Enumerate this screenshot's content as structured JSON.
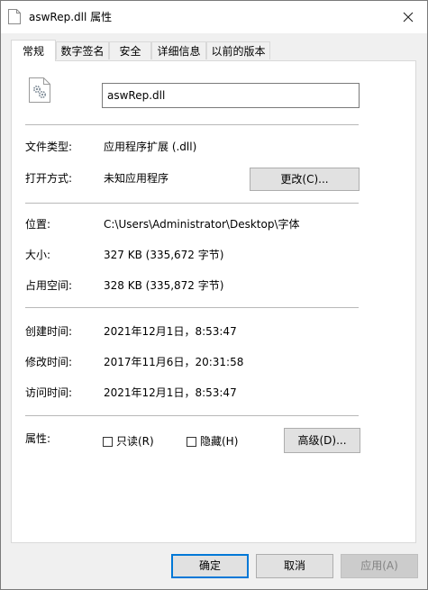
{
  "window": {
    "title": "aswRep.dll 属性"
  },
  "tabs": [
    "常规",
    "数字签名",
    "安全",
    "详细信息",
    "以前的版本"
  ],
  "file": {
    "name": "aswRep.dll"
  },
  "props": {
    "type_label": "文件类型:",
    "type_value": "应用程序扩展 (.dll)",
    "open_label": "打开方式:",
    "open_value": "未知应用程序",
    "change_button": "更改(C)...",
    "location_label": "位置:",
    "location_value": "C:\\Users\\Administrator\\Desktop\\字体",
    "size_label": "大小:",
    "size_value": "327 KB (335,672 字节)",
    "disk_label": "占用空间:",
    "disk_value": "328 KB (335,872 字节)",
    "created_label": "创建时间:",
    "created_value": "2021年12月1日，8:53:47",
    "modified_label": "修改时间:",
    "modified_value": "2017年11月6日，20:31:58",
    "accessed_label": "访问时间:",
    "accessed_value": "2021年12月1日，8:53:47",
    "attr_label": "属性:",
    "readonly_label": "只读(R)",
    "hidden_label": "隐藏(H)",
    "advanced_button": "高级(D)..."
  },
  "footer": {
    "ok": "确定",
    "cancel": "取消",
    "apply": "应用(A)"
  }
}
